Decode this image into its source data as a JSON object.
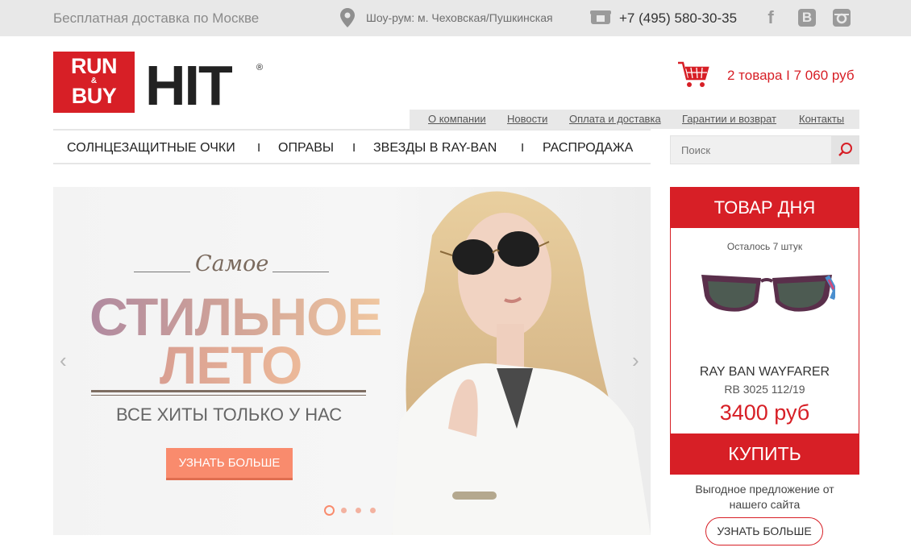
{
  "topbar": {
    "delivery": "Бесплатная доставка по Москве",
    "showroom": "Шоу-рум: м. Чеховская/Пушкинская",
    "phone": "+7 (495) 580-30-35",
    "socials": [
      "facebook-icon",
      "vk-icon",
      "instagram-icon"
    ]
  },
  "logo": {
    "line1": "RUN",
    "amp": "&",
    "line2": "BUY",
    "brand": "HIT",
    "reg": "®"
  },
  "cart": {
    "text": "2 товара I 7 060 руб"
  },
  "subnav": [
    "О компании",
    "Новости",
    "Оплата и доставка",
    "Гарантии и возврат",
    "Контакты"
  ],
  "mainnav": {
    "items": [
      "СОЛНЦЕЗАЩИТНЫЕ ОЧКИ",
      "ОПРАВЫ",
      "ЗВЕЗДЫ В RAY-BAN",
      "РАСПРОДАЖА"
    ],
    "separator": "I"
  },
  "search": {
    "placeholder": "Поиск"
  },
  "hero": {
    "script_word": "Самое",
    "title1": "СТИЛЬНОЕ",
    "title2": "ЛЕТО",
    "subtitle": "ВСЕ ХИТЫ ТОЛЬКО У НАС",
    "cta": "УЗНАТЬ БОЛЬШЕ",
    "prev": "‹",
    "next": "›",
    "slides": 4,
    "active_slide": 1
  },
  "deal": {
    "header": "ТОВАР ДНЯ",
    "left": "Осталось 7 штук",
    "name": "RAY BAN WAYFARER",
    "model": "RB 3025 112/19",
    "price": "3400 руб",
    "buy": "КУПИТЬ"
  },
  "offer": {
    "line1": "Выгодное предложение от",
    "line2": "нашего сайта",
    "button": "УЗНАТЬ БОЛЬШЕ"
  },
  "colors": {
    "brand_red": "#d71f26",
    "cta_orange": "#f98b6d",
    "topbar_bg": "#e8e8e8"
  }
}
